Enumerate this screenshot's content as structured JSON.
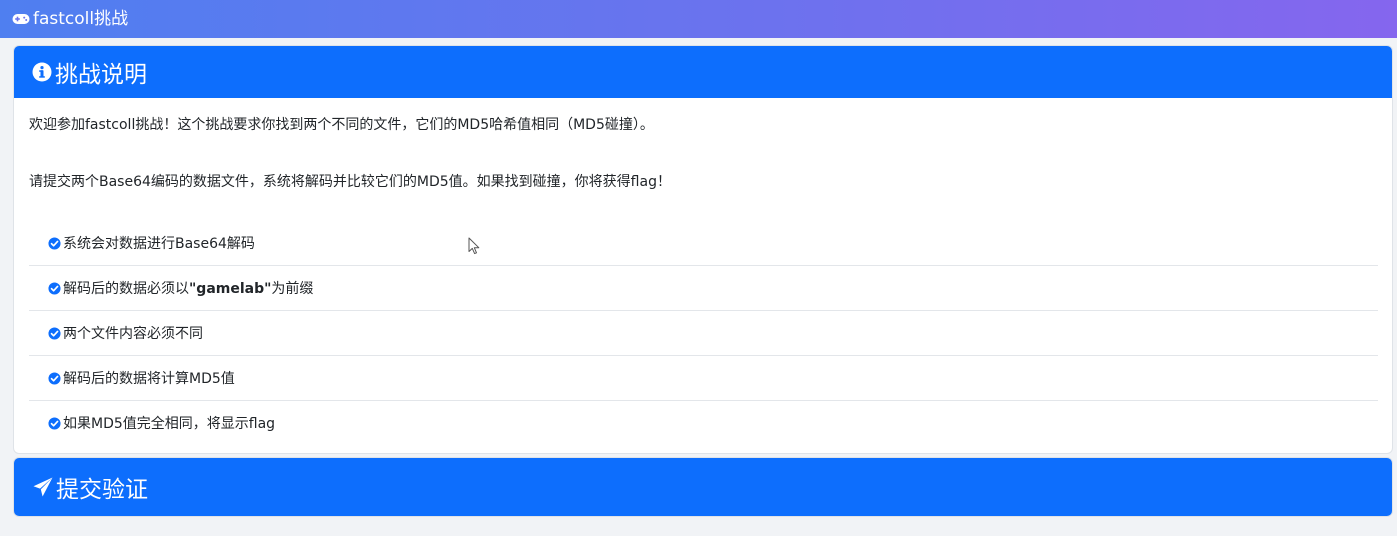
{
  "navbar": {
    "title": "fastcoll挑战",
    "icon": "gamepad-icon"
  },
  "intro_card": {
    "header": "挑战说明",
    "icon": "info-circle-icon",
    "paragraph1": "欢迎参加fastcoll挑战！这个挑战要求你找到两个不同的文件，它们的MD5哈希值相同（MD5碰撞）。",
    "paragraph2": "请提交两个Base64编码的数据文件，系统将解码并比较它们的MD5值。如果找到碰撞，你将获得flag！",
    "rules": [
      {
        "text": "系统会对数据进行Base64解码"
      },
      {
        "before": "解码后的数据必须以",
        "bold": "\"gamelab\"",
        "after": "为前缀"
      },
      {
        "text": "两个文件内容必须不同"
      },
      {
        "text": "解码后的数据将计算MD5值"
      },
      {
        "text": "如果MD5值完全相同，将显示flag"
      }
    ],
    "check_icon": "check-circle-icon",
    "check_color": "#0d6efd"
  },
  "submit_card": {
    "header": "提交验证",
    "icon": "paper-plane-icon"
  },
  "colors": {
    "primary": "#0d6efd",
    "navbar_start": "#4f7ff0",
    "navbar_end": "#8566ee"
  }
}
